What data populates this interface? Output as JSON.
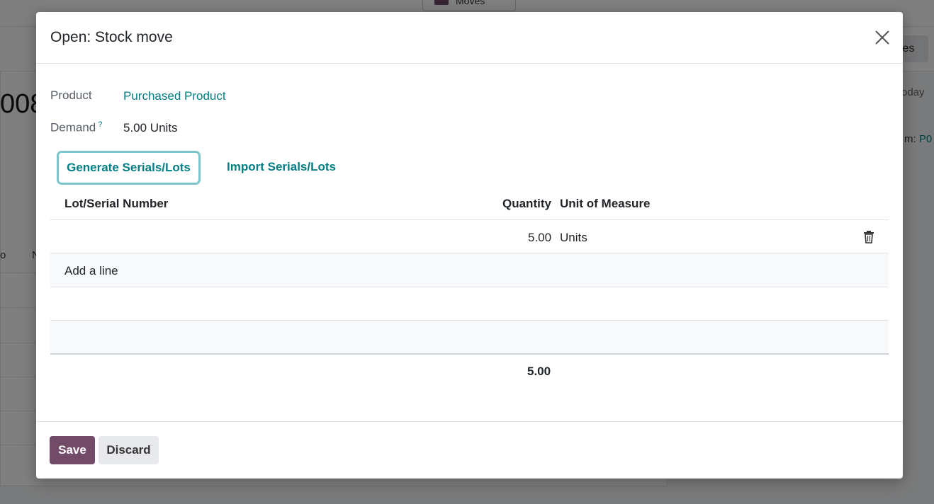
{
  "background": {
    "moves_button_label": "Moves",
    "right_button_label": "ies",
    "reference_partial": "008",
    "date_label_partial": "oday",
    "source_label_partial": "m:",
    "source_value_partial": "P0",
    "col_partial_1": "o",
    "col_partial_2": "N"
  },
  "dialog": {
    "title": "Open: Stock move",
    "product_label": "Product",
    "product_value": "Purchased Product",
    "demand_label": "Demand",
    "demand_help": "?",
    "demand_value": "5.00 Units",
    "generate_button": "Generate Serials/Lots",
    "import_button": "Import Serials/Lots",
    "table": {
      "headers": [
        "Lot/Serial Number",
        "Quantity",
        "Unit of Measure"
      ],
      "rows": [
        {
          "lot": "",
          "quantity": "5.00",
          "uom": "Units"
        }
      ],
      "add_line": "Add a line",
      "total_quantity": "5.00"
    },
    "save_button": "Save",
    "discard_button": "Discard"
  },
  "colors": {
    "accent": "#017e84",
    "primary": "#714B67"
  },
  "icons": {
    "close": "close-icon",
    "delete": "trash-icon"
  }
}
